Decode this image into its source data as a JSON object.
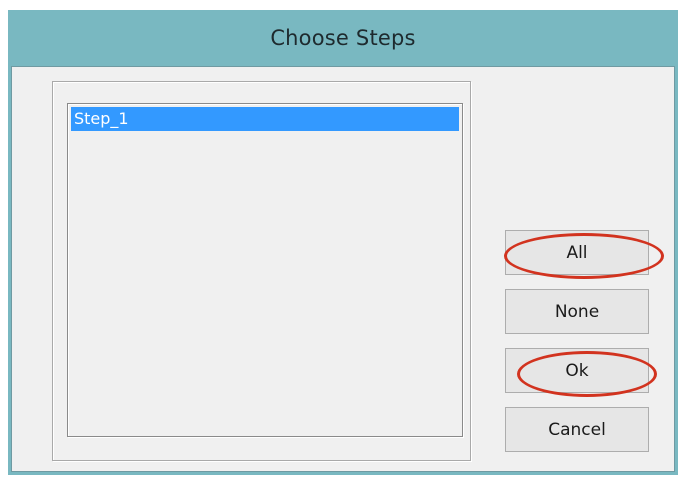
{
  "window": {
    "title": "Choose Steps"
  },
  "steps_list": {
    "items": [
      {
        "label": "Step_1",
        "selected": true
      }
    ]
  },
  "buttons": {
    "all_label": "All",
    "none_label": "None",
    "ok_label": "Ok",
    "cancel_label": "Cancel"
  },
  "colors": {
    "titlebar": "#79b8c1",
    "selection": "#3399ff",
    "annotation": "#d2331f"
  }
}
